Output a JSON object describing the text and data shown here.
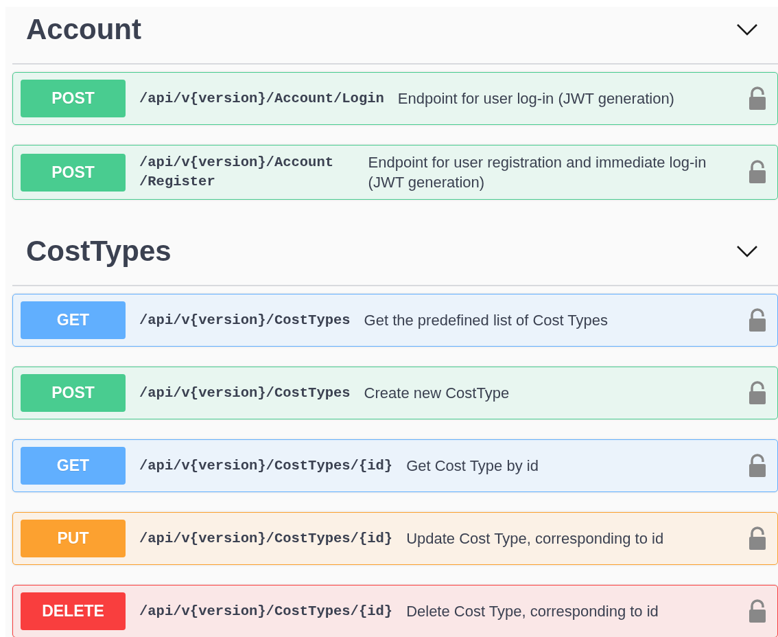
{
  "sections": [
    {
      "title": "Account",
      "expanded": true,
      "operations": [
        {
          "kind": "post",
          "method": "POST",
          "path": "/api/v{version}/Account/Login",
          "summary": "Endpoint for user log-in (JWT generation)",
          "locked": false
        },
        {
          "kind": "post",
          "method": "POST",
          "path": "/api/v{version}/Account/Register",
          "summary": "Endpoint for user registration and immediate log-in (JWT generation)",
          "locked": false
        }
      ]
    },
    {
      "title": "CostTypes",
      "expanded": true,
      "operations": [
        {
          "kind": "get",
          "method": "GET",
          "path": "/api/v{version}/CostTypes",
          "summary": "Get the predefined list of Cost Types",
          "locked": false
        },
        {
          "kind": "post",
          "method": "POST",
          "path": "/api/v{version}/CostTypes",
          "summary": "Create new CostType",
          "locked": false
        },
        {
          "kind": "get",
          "method": "GET",
          "path": "/api/v{version}/CostTypes/{id}",
          "summary": "Get Cost Type by id",
          "locked": false
        },
        {
          "kind": "put",
          "method": "PUT",
          "path": "/api/v{version}/CostTypes/{id}",
          "summary": "Update Cost Type, corresponding to id",
          "locked": false
        },
        {
          "kind": "delete",
          "method": "DELETE",
          "path": "/api/v{version}/CostTypes/{id}",
          "summary": "Delete Cost Type, corresponding to id",
          "locked": false
        }
      ]
    }
  ]
}
